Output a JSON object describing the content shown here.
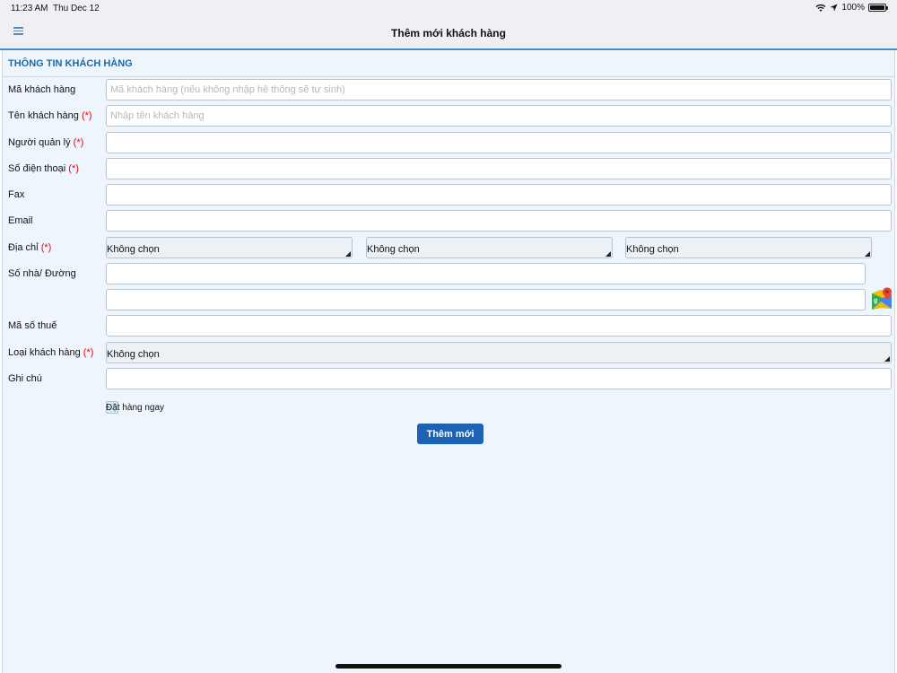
{
  "status_bar": {
    "time": "11:23 AM",
    "date": "Thu Dec 12",
    "battery": "100%"
  },
  "nav": {
    "title": "Thêm mới khách hàng"
  },
  "section": {
    "title": "THÔNG TIN KHÁCH HÀNG"
  },
  "form": {
    "required_marker": "(*)",
    "customer_code": {
      "label": "Mã khách hàng",
      "placeholder": "Mã khách hàng (nếu không nhập hệ thống sẽ tự sinh)",
      "value": ""
    },
    "customer_name": {
      "label": "Tên khách hàng",
      "placeholder": "Nhập tên khách hàng",
      "value": ""
    },
    "manager": {
      "label": "Người quản lý",
      "value": ""
    },
    "phone": {
      "label": "Số điện thoại",
      "value": ""
    },
    "fax": {
      "label": "Fax",
      "value": ""
    },
    "email": {
      "label": "Email",
      "value": ""
    },
    "address": {
      "label": "Địa chỉ",
      "select_1": "Không chọn",
      "select_2": "Không chọn",
      "select_3": "Không chọn"
    },
    "street": {
      "label": "Số nhà/ Đường",
      "value": "",
      "value_2": ""
    },
    "tax_code": {
      "label": "Mã số thuế",
      "value": ""
    },
    "customer_type": {
      "label": "Loại khách hàng",
      "selected": "Không chọn"
    },
    "note": {
      "label": "Ghi chú",
      "value": ""
    },
    "order_now": {
      "label": "Đặt hàng ngay",
      "checked": false
    },
    "submit_label": "Thêm mới"
  },
  "icons": {
    "menu": "hamburger-icon",
    "map": "google-maps-icon",
    "wifi": "wifi-icon",
    "location": "location-arrow-icon",
    "battery": "battery-icon"
  },
  "colors": {
    "accent": "#1a64b3",
    "section_title": "#1a6ab0",
    "required": "#e00000",
    "content_bg": "#eef5fd"
  }
}
